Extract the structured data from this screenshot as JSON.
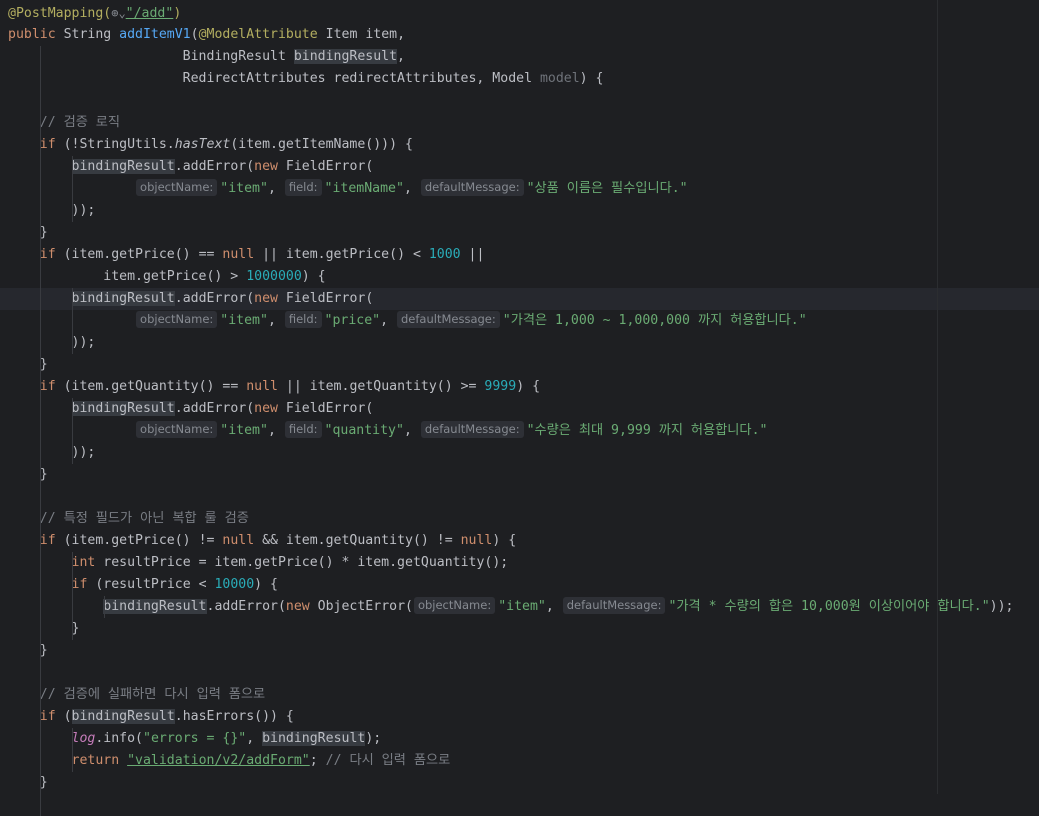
{
  "editor": {
    "language": "Java",
    "current_line": 13,
    "hint_names": {
      "object_name": "objectName:",
      "field": "field:",
      "default_message": "defaultMessage:"
    },
    "globe_icon": "globe-icon",
    "lines": [
      [
        [
          "ann",
          "@PostMapping("
        ],
        [
          "globe",
          "⊕⌄"
        ],
        [
          "str url",
          "\"/add\""
        ],
        [
          "ann",
          ")"
        ]
      ],
      [
        [
          "kw",
          "public "
        ],
        [
          "",
          "String "
        ],
        [
          "fn",
          "addItemV1"
        ],
        [
          "",
          "("
        ],
        [
          "ann",
          "@ModelAttribute "
        ],
        [
          "",
          "Item item,"
        ]
      ],
      [
        [
          "",
          "                      BindingResult "
        ],
        [
          "hl",
          "bindingResult"
        ],
        [
          "",
          ","
        ]
      ],
      [
        [
          "",
          "                      RedirectAttributes redirectAttributes, Model "
        ],
        [
          "param",
          "model"
        ],
        [
          "",
          ") {"
        ]
      ],
      [],
      [
        [
          "cm",
          "    // 검증 로직"
        ]
      ],
      [
        [
          "",
          "    "
        ],
        [
          "kw",
          "if "
        ],
        [
          "",
          "(!StringUtils."
        ],
        [
          "static",
          "hasText"
        ],
        [
          "",
          "(item.getItemName())) {"
        ]
      ],
      [
        [
          "",
          "        "
        ],
        [
          "hl",
          "bindingResult"
        ],
        [
          "",
          ".addError("
        ],
        [
          "kw",
          "new "
        ],
        [
          "",
          "FieldError("
        ]
      ],
      [
        [
          "",
          "                "
        ],
        [
          "hint",
          "objectName:"
        ],
        [
          "str",
          "\"item\""
        ],
        [
          "",
          ", "
        ],
        [
          "hint",
          "field:"
        ],
        [
          "str",
          "\"itemName\""
        ],
        [
          "",
          ", "
        ],
        [
          "hint",
          "defaultMessage:"
        ],
        [
          "str",
          "\"상품 이름은 필수입니다.\""
        ]
      ],
      [
        [
          "",
          "        ));"
        ]
      ],
      [
        [
          "",
          "    }"
        ]
      ],
      [
        [
          "",
          "    "
        ],
        [
          "kw",
          "if "
        ],
        [
          "",
          "(item.getPrice() == "
        ],
        [
          "kw",
          "null "
        ],
        [
          "",
          "|| item.getPrice() < "
        ],
        [
          "num",
          "1000 "
        ],
        [
          "",
          "||"
        ]
      ],
      [
        [
          "",
          "            item.getPrice() > "
        ],
        [
          "num",
          "1000000"
        ],
        [
          "",
          ") {"
        ]
      ],
      [
        [
          "",
          "        "
        ],
        [
          "hl",
          "bindingResult"
        ],
        [
          "",
          ".addError("
        ],
        [
          "kw",
          "new "
        ],
        [
          "",
          "FieldError("
        ]
      ],
      [
        [
          "",
          "                "
        ],
        [
          "hint",
          "objectName:"
        ],
        [
          "str",
          "\"item\""
        ],
        [
          "",
          ", "
        ],
        [
          "hint",
          "field:"
        ],
        [
          "str",
          "\"price\""
        ],
        [
          "",
          ", "
        ],
        [
          "hint",
          "defaultMessage:"
        ],
        [
          "str",
          "\"가격은 1,000 ~ 1,000,000 까지 허용합니다.\""
        ]
      ],
      [
        [
          "",
          "        ));"
        ]
      ],
      [
        [
          "",
          "    }"
        ]
      ],
      [
        [
          "",
          "    "
        ],
        [
          "kw",
          "if "
        ],
        [
          "",
          "(item.getQuantity() == "
        ],
        [
          "kw",
          "null "
        ],
        [
          "",
          "|| item.getQuantity() >= "
        ],
        [
          "num",
          "9999"
        ],
        [
          "",
          ") {"
        ]
      ],
      [
        [
          "",
          "        "
        ],
        [
          "hl",
          "bindingResult"
        ],
        [
          "",
          ".addError("
        ],
        [
          "kw",
          "new "
        ],
        [
          "",
          "FieldError("
        ]
      ],
      [
        [
          "",
          "                "
        ],
        [
          "hint",
          "objectName:"
        ],
        [
          "str",
          "\"item\""
        ],
        [
          "",
          ", "
        ],
        [
          "hint",
          "field:"
        ],
        [
          "str",
          "\"quantity\""
        ],
        [
          "",
          ", "
        ],
        [
          "hint",
          "defaultMessage:"
        ],
        [
          "str",
          "\"수량은 최대 9,999 까지 허용합니다.\""
        ]
      ],
      [
        [
          "",
          "        ));"
        ]
      ],
      [
        [
          "",
          "    }"
        ]
      ],
      [],
      [
        [
          "cm",
          "    // 특정 필드가 아닌 복합 룰 검증"
        ]
      ],
      [
        [
          "",
          "    "
        ],
        [
          "kw",
          "if "
        ],
        [
          "",
          "(item.getPrice() != "
        ],
        [
          "kw",
          "null "
        ],
        [
          "",
          "&& item.getQuantity() != "
        ],
        [
          "kw",
          "null"
        ],
        [
          "",
          ") {"
        ]
      ],
      [
        [
          "",
          "        "
        ],
        [
          "kw",
          "int "
        ],
        [
          "",
          "resultPrice = item.getPrice() * item.getQuantity();"
        ]
      ],
      [
        [
          "",
          "        "
        ],
        [
          "kw",
          "if "
        ],
        [
          "",
          "(resultPrice < "
        ],
        [
          "num",
          "10000"
        ],
        [
          "",
          ") {"
        ]
      ],
      [
        [
          "",
          "            "
        ],
        [
          "hl",
          "bindingResult"
        ],
        [
          "",
          ".addError("
        ],
        [
          "kw",
          "new "
        ],
        [
          "",
          "ObjectError("
        ],
        [
          "hint",
          "objectName:"
        ],
        [
          "str",
          "\"item\""
        ],
        [
          "",
          ", "
        ],
        [
          "hint",
          "defaultMessage:"
        ],
        [
          "str",
          "\"가격 * 수량의 합은 10,000원 이상이어야 합니다.\""
        ],
        [
          "",
          "));"
        ]
      ],
      [
        [
          "",
          "        }"
        ]
      ],
      [
        [
          "",
          "    }"
        ]
      ],
      [],
      [
        [
          "cm",
          "    // 검증에 실패하면 다시 입력 폼으로"
        ]
      ],
      [
        [
          "",
          "    "
        ],
        [
          "kw",
          "if "
        ],
        [
          "",
          "("
        ],
        [
          "hl",
          "bindingResult"
        ],
        [
          "",
          ".hasErrors()) {"
        ]
      ],
      [
        [
          "",
          "        "
        ],
        [
          "field italic",
          "log"
        ],
        [
          "",
          ".info("
        ],
        [
          "str",
          "\"errors = {}\""
        ],
        [
          "",
          ", "
        ],
        [
          "hl",
          "bindingResult"
        ],
        [
          "",
          ");"
        ]
      ],
      [
        [
          "",
          "        "
        ],
        [
          "kw",
          "return "
        ],
        [
          "str url",
          "\"validation/v2/addForm\""
        ],
        [
          "",
          "; "
        ],
        [
          "cm",
          "// 다시 입력 폼으로"
        ]
      ],
      [
        [
          "",
          "    }"
        ]
      ]
    ]
  }
}
